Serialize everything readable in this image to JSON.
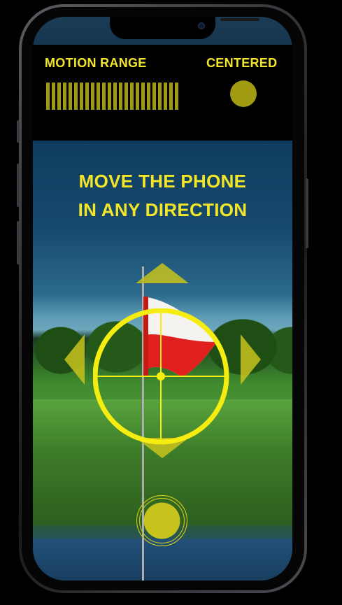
{
  "header": {
    "motion_range_label": "MOTION RANGE",
    "centered_label": "CENTERED",
    "motion_range_level": 1.0,
    "centered_active": true
  },
  "main": {
    "instruction_line1": "MOVE THE PHONE",
    "instruction_line2": "IN ANY DIRECTION"
  },
  "colors": {
    "accent": "#f3e629",
    "dim_accent": "#a09b10",
    "arrow": "#c8c31c"
  },
  "icons": {
    "up": "arrow-up-icon",
    "down": "arrow-down-icon",
    "left": "arrow-left-icon",
    "right": "arrow-right-icon",
    "reticle": "crosshair-reticle-icon",
    "capture": "capture-button-icon"
  }
}
